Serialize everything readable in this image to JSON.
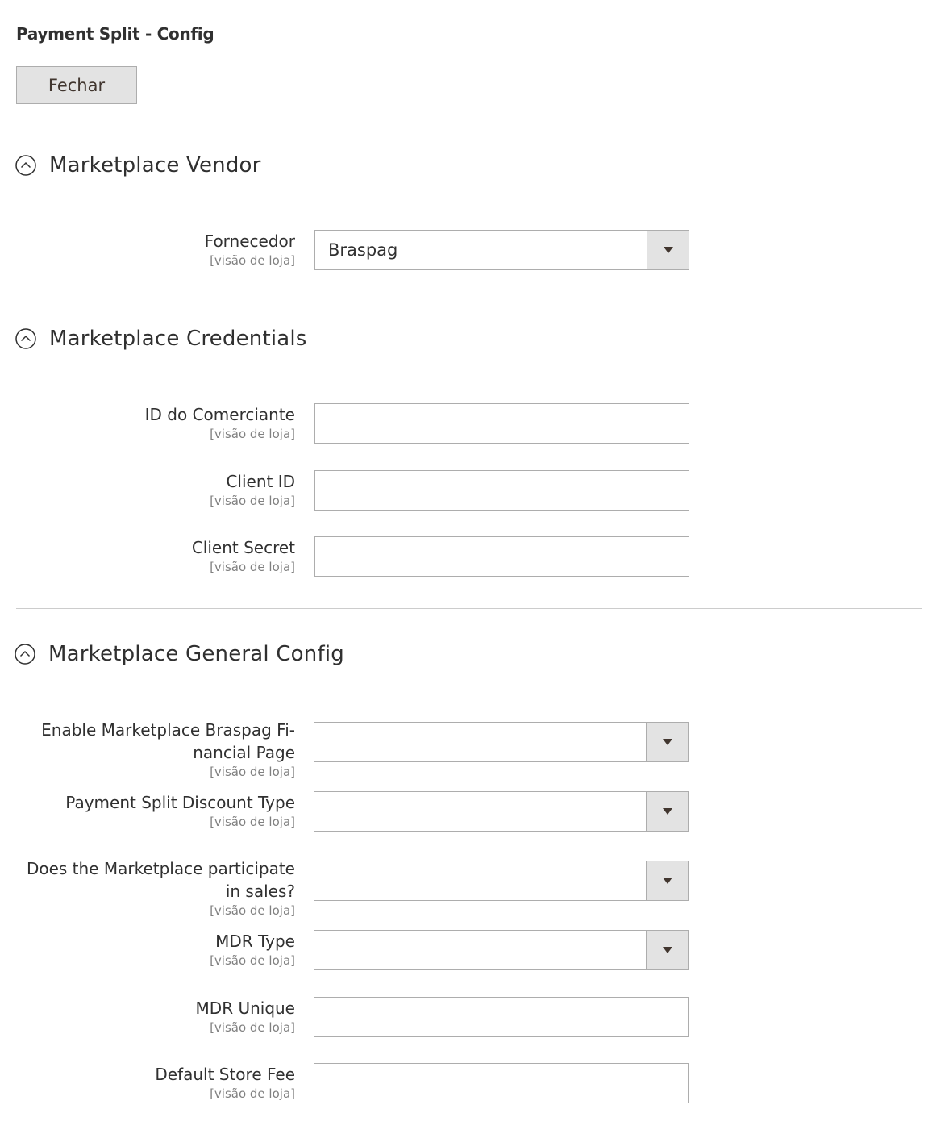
{
  "page": {
    "title": "Payment Split - Config"
  },
  "actions": {
    "close_label": "Fechar"
  },
  "scope_label": "[visão de loja]",
  "sections": {
    "vendor": {
      "title": "Marketplace Vendor",
      "fields": {
        "fornecedor": {
          "label": "Fornecedor",
          "value": "Braspag"
        }
      }
    },
    "credentials": {
      "title": "Marketplace Credentials",
      "fields": {
        "merchant_id": {
          "label": "ID do Comerciante",
          "value": ""
        },
        "client_id": {
          "label": "Client ID",
          "value": ""
        },
        "client_secret": {
          "label": "Client Secret",
          "value": ""
        }
      }
    },
    "general": {
      "title": "Marketplace General Config",
      "fields": {
        "financial_page": {
          "label_line1": "Enable Marketplace Braspag Fi-",
          "label_line2": "nancial Page",
          "value": ""
        },
        "discount_type": {
          "label": "Payment Split Discount Type",
          "value": ""
        },
        "participate": {
          "label_line1": "Does the Marketplace participate",
          "label_line2": "in sales?",
          "value": ""
        },
        "mdr_type": {
          "label": "MDR Type",
          "value": ""
        },
        "mdr_unique": {
          "label": "MDR Unique",
          "value": ""
        },
        "store_fee": {
          "label": "Default Store Fee",
          "value": ""
        }
      }
    }
  },
  "icons": {
    "collapse": "chevron-up-circle-icon",
    "dropdown": "triangle-down-icon"
  },
  "colors": {
    "button_bg": "#e3e3e3",
    "border": "#adadad",
    "text": "#303030",
    "scope": "#808080",
    "divider": "#cccccc"
  }
}
